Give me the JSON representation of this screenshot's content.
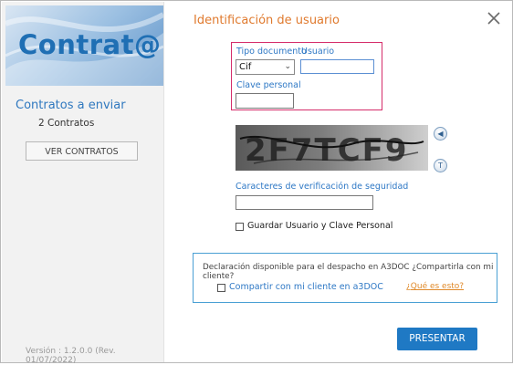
{
  "sidebar": {
    "logo_text": "Contrat@",
    "title": "Contratos a enviar",
    "count": "2 Contratos",
    "view_button": "VER CONTRATOS",
    "version": "Versión : 1.2.0.0 (Rev. 01/07/2022)"
  },
  "dialog": {
    "title": "Identificación de usuario",
    "close_icon": "close-icon"
  },
  "login": {
    "tipo_label": "Tipo documento",
    "tipo_value": "Cif",
    "usuario_label": "Usuario",
    "usuario_value": "",
    "clave_label": "Clave personal",
    "clave_value": ""
  },
  "captcha": {
    "image_text": "2F7TCF9",
    "audio_icon": "speaker-icon",
    "refresh_icon": "refresh-icon",
    "label": "Caracteres de verificación de seguridad",
    "value": ""
  },
  "remember": {
    "label": "Guardar Usuario y Clave Personal",
    "checked": false
  },
  "declaration": {
    "text": "Declaración disponible para el despacho en A3DOC ¿Compartirla con mi cliente?",
    "share_label": "Compartir con mi cliente en a3DOC",
    "share_checked": false,
    "help_link": "¿Qué es esto?"
  },
  "actions": {
    "submit": "PRESENTAR"
  },
  "colors": {
    "accent_blue": "#1f79c4",
    "title_orange": "#e07a2e",
    "highlight_magenta": "#d52c6a"
  }
}
